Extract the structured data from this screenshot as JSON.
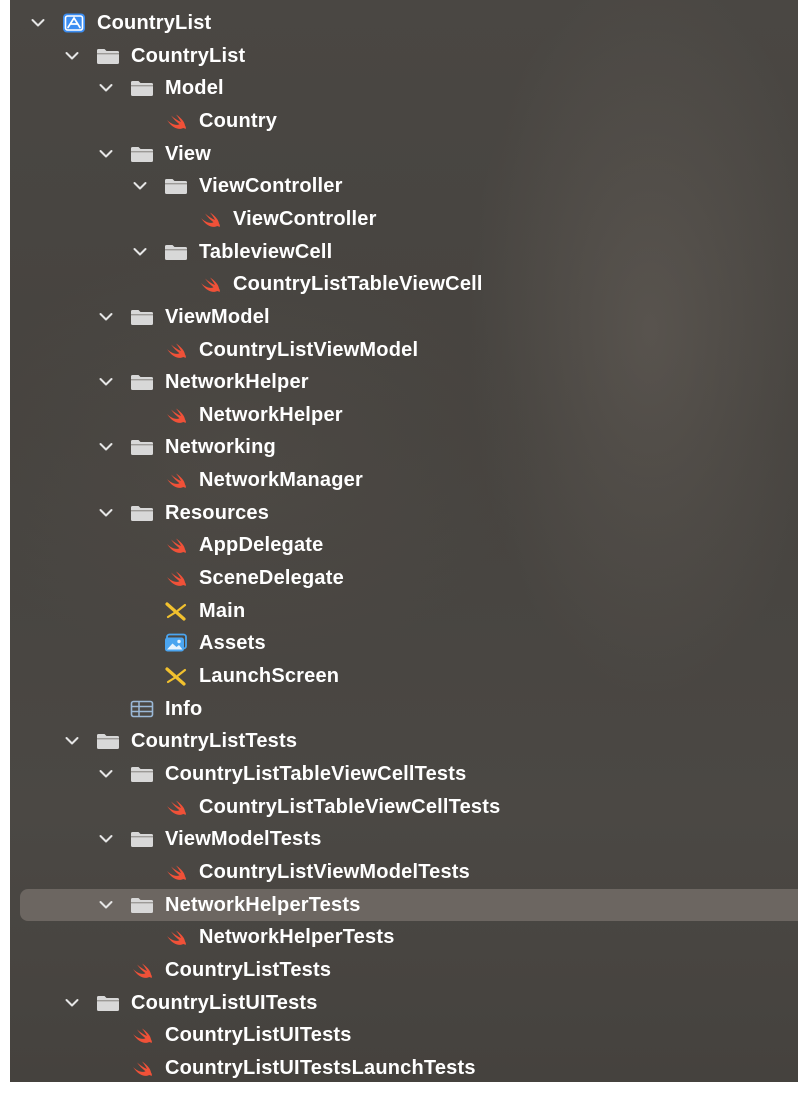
{
  "navigator": {
    "colors": {
      "background": "#47443f",
      "selection": "#6c6661",
      "folder": "#d8d8d8",
      "swift": "#f05138",
      "project": "#3b8df2",
      "storyboard": "#f2c12e",
      "assets": "#4ba5f0",
      "plist": "#9bb8d6"
    },
    "items": [
      {
        "label": "CountryList",
        "type": "project",
        "depth": 0,
        "expanded": true,
        "selected": false
      },
      {
        "label": "CountryList",
        "type": "folder",
        "depth": 1,
        "expanded": true,
        "selected": false
      },
      {
        "label": "Model",
        "type": "folder",
        "depth": 2,
        "expanded": true,
        "selected": false
      },
      {
        "label": "Country",
        "type": "swift",
        "depth": 3,
        "selected": false
      },
      {
        "label": "View",
        "type": "folder",
        "depth": 2,
        "expanded": true,
        "selected": false
      },
      {
        "label": "ViewController",
        "type": "folder",
        "depth": 3,
        "expanded": true,
        "selected": false
      },
      {
        "label": "ViewController",
        "type": "swift",
        "depth": 4,
        "selected": false
      },
      {
        "label": "TableviewCell",
        "type": "folder",
        "depth": 3,
        "expanded": true,
        "selected": false
      },
      {
        "label": "CountryListTableViewCell",
        "type": "swift",
        "depth": 4,
        "selected": false
      },
      {
        "label": "ViewModel",
        "type": "folder",
        "depth": 2,
        "expanded": true,
        "selected": false
      },
      {
        "label": "CountryListViewModel",
        "type": "swift",
        "depth": 3,
        "selected": false
      },
      {
        "label": "NetworkHelper",
        "type": "folder",
        "depth": 2,
        "expanded": true,
        "selected": false
      },
      {
        "label": "NetworkHelper",
        "type": "swift",
        "depth": 3,
        "selected": false
      },
      {
        "label": "Networking",
        "type": "folder",
        "depth": 2,
        "expanded": true,
        "selected": false
      },
      {
        "label": "NetworkManager",
        "type": "swift",
        "depth": 3,
        "selected": false
      },
      {
        "label": "Resources",
        "type": "folder",
        "depth": 2,
        "expanded": true,
        "selected": false
      },
      {
        "label": "AppDelegate",
        "type": "swift",
        "depth": 3,
        "selected": false
      },
      {
        "label": "SceneDelegate",
        "type": "swift",
        "depth": 3,
        "selected": false
      },
      {
        "label": "Main",
        "type": "storyboard",
        "depth": 3,
        "selected": false
      },
      {
        "label": "Assets",
        "type": "assets",
        "depth": 3,
        "selected": false
      },
      {
        "label": "LaunchScreen",
        "type": "storyboard",
        "depth": 3,
        "selected": false
      },
      {
        "label": "Info",
        "type": "plist",
        "depth": 2,
        "selected": false
      },
      {
        "label": "CountryListTests",
        "type": "folder",
        "depth": 1,
        "expanded": true,
        "selected": false
      },
      {
        "label": "CountryListTableViewCellTests",
        "type": "folder",
        "depth": 2,
        "expanded": true,
        "selected": false
      },
      {
        "label": "CountryListTableViewCellTests",
        "type": "swift",
        "depth": 3,
        "selected": false
      },
      {
        "label": "ViewModelTests",
        "type": "folder",
        "depth": 2,
        "expanded": true,
        "selected": false
      },
      {
        "label": "CountryListViewModelTests",
        "type": "swift",
        "depth": 3,
        "selected": false
      },
      {
        "label": "NetworkHelperTests",
        "type": "folder",
        "depth": 2,
        "expanded": true,
        "selected": true
      },
      {
        "label": "NetworkHelperTests",
        "type": "swift",
        "depth": 3,
        "selected": false
      },
      {
        "label": "CountryListTests",
        "type": "swift",
        "depth": 2,
        "selected": false
      },
      {
        "label": "CountryListUITests",
        "type": "folder",
        "depth": 1,
        "expanded": true,
        "selected": false
      },
      {
        "label": "CountryListUITests",
        "type": "swift",
        "depth": 2,
        "selected": false
      },
      {
        "label": "CountryListUITestsLaunchTests",
        "type": "swift",
        "depth": 2,
        "selected": false
      }
    ]
  }
}
